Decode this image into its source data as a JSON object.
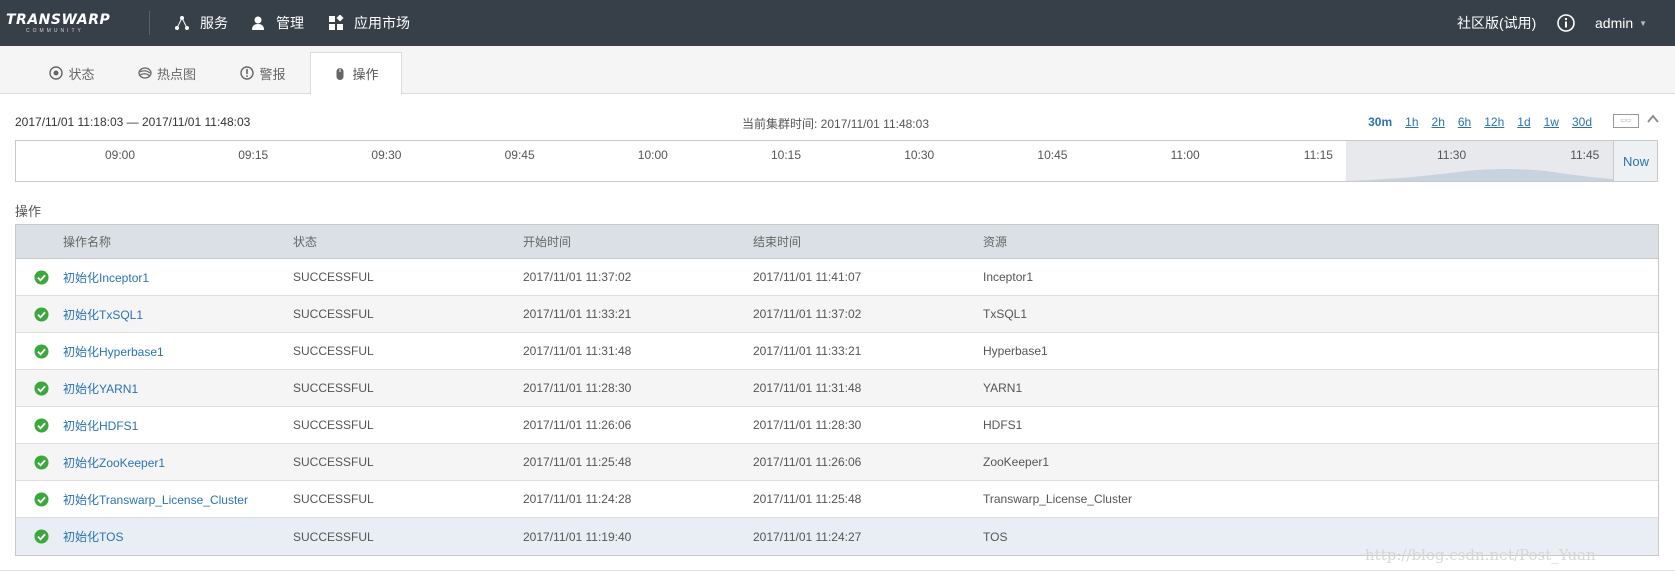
{
  "navbar": {
    "brand": "TRANSWARP",
    "brand_sub": "COMMUNITY",
    "items": [
      {
        "label": "服务",
        "icon": "services-icon"
      },
      {
        "label": "管理",
        "icon": "user-icon"
      },
      {
        "label": "应用市场",
        "icon": "app-grid-icon"
      }
    ],
    "edition": "社区版(试用)",
    "info_icon": "info-icon",
    "user": "admin"
  },
  "tabs": [
    {
      "label": "状态",
      "icon": "target-icon",
      "active": false
    },
    {
      "label": "热点图",
      "icon": "heatmap-icon",
      "active": false
    },
    {
      "label": "警报",
      "icon": "alert-icon",
      "active": false
    },
    {
      "label": "操作",
      "icon": "mouse-icon",
      "active": true
    }
  ],
  "time_range": {
    "range": "2017/11/01 11:18:03 — 2017/11/01 11:48:03",
    "cluster_time": "当前集群时间: 2017/11/01 11:48:03",
    "presets": [
      "30m",
      "1h",
      "2h",
      "6h",
      "12h",
      "1d",
      "1w",
      "30d"
    ],
    "active_preset": "30m",
    "calendar_icon": "calendar-icon",
    "collapse_icon": "chevron-up-icon"
  },
  "timeline": {
    "ticks": [
      "09:00",
      "09:15",
      "09:30",
      "09:45",
      "10:00",
      "10:15",
      "10:30",
      "10:45",
      "11:00",
      "11:15",
      "11:30",
      "11:45"
    ],
    "now_label": "Now"
  },
  "operations": {
    "title": "操作",
    "columns": [
      "操作名称",
      "状态",
      "开始时间",
      "结束时间",
      "资源"
    ],
    "rows": [
      {
        "name": "初始化Inceptor1",
        "status": "SUCCESSFUL",
        "start": "2017/11/01 11:37:02",
        "end": "2017/11/01 11:41:07",
        "resource": "Inceptor1"
      },
      {
        "name": "初始化TxSQL1",
        "status": "SUCCESSFUL",
        "start": "2017/11/01 11:33:21",
        "end": "2017/11/01 11:37:02",
        "resource": "TxSQL1"
      },
      {
        "name": "初始化Hyperbase1",
        "status": "SUCCESSFUL",
        "start": "2017/11/01 11:31:48",
        "end": "2017/11/01 11:33:21",
        "resource": "Hyperbase1"
      },
      {
        "name": "初始化YARN1",
        "status": "SUCCESSFUL",
        "start": "2017/11/01 11:28:30",
        "end": "2017/11/01 11:31:48",
        "resource": "YARN1"
      },
      {
        "name": "初始化HDFS1",
        "status": "SUCCESSFUL",
        "start": "2017/11/01 11:26:06",
        "end": "2017/11/01 11:28:30",
        "resource": "HDFS1"
      },
      {
        "name": "初始化ZooKeeper1",
        "status": "SUCCESSFUL",
        "start": "2017/11/01 11:25:48",
        "end": "2017/11/01 11:26:06",
        "resource": "ZooKeeper1"
      },
      {
        "name": "初始化Transwarp_License_Cluster",
        "status": "SUCCESSFUL",
        "start": "2017/11/01 11:24:28",
        "end": "2017/11/01 11:25:48",
        "resource": "Transwarp_License_Cluster"
      },
      {
        "name": "初始化TOS",
        "status": "SUCCESSFUL",
        "start": "2017/11/01 11:19:40",
        "end": "2017/11/01 11:24:27",
        "resource": "TOS"
      }
    ]
  },
  "watermark": "http://blog.csdn.net/Post_Yuan",
  "colors": {
    "navbar": "#373f48",
    "link": "#2a72b5",
    "success": "#3aa83a",
    "table_header": "#dbe0e6"
  }
}
